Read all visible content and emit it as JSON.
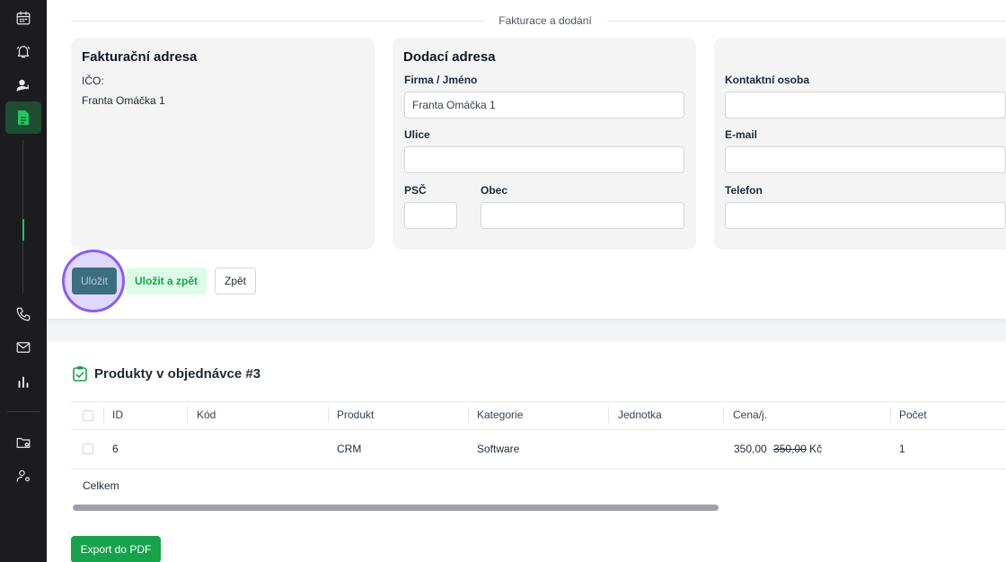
{
  "section": {
    "title": "Fakturace a dodání"
  },
  "billing": {
    "title": "Fakturační adresa",
    "ico_label": "IČO:",
    "name": "Franta Omáčka 1"
  },
  "delivery": {
    "title": "Dodací adresa",
    "company_label": "Firma / Jméno",
    "company_value": "Franta Omáčka 1",
    "street_label": "Ulice",
    "street_value": "",
    "zip_label": "PSČ",
    "zip_value": "",
    "city_label": "Obec",
    "city_value": ""
  },
  "contact": {
    "person_label": "Kontaktní osoba",
    "person_value": "",
    "email_label": "E-mail",
    "email_value": "",
    "phone_label": "Telefon",
    "phone_value": ""
  },
  "actions": {
    "save": "Uložit",
    "save_back": "Uložit a zpět",
    "back": "Zpět"
  },
  "products": {
    "title": "Produkty v objednávce #3",
    "columns": [
      "ID",
      "Kód",
      "Produkt",
      "Kategorie",
      "Jednotka",
      "Cena/j.",
      "Počet"
    ],
    "rows": [
      {
        "id": "6",
        "code": "",
        "product": "CRM",
        "category": "Software",
        "unit": "",
        "price": "350,00",
        "price_old": "350,00",
        "currency": "Kč",
        "count": "1"
      }
    ],
    "total_label": "Celkem",
    "export": "Export do PDF"
  },
  "sidebar": {
    "icons": [
      "calendar-icon",
      "bell-icon",
      "user-icon",
      "document-icon",
      "phone-icon",
      "mail-icon",
      "chart-icon",
      "folder-icon",
      "user-settings-icon"
    ],
    "active": "document-icon"
  },
  "colors": {
    "accent": "#16a34a",
    "sidebar_bg": "#1c1c1e",
    "save_button": "#3c6e80",
    "highlight": "#8b5cf6"
  }
}
